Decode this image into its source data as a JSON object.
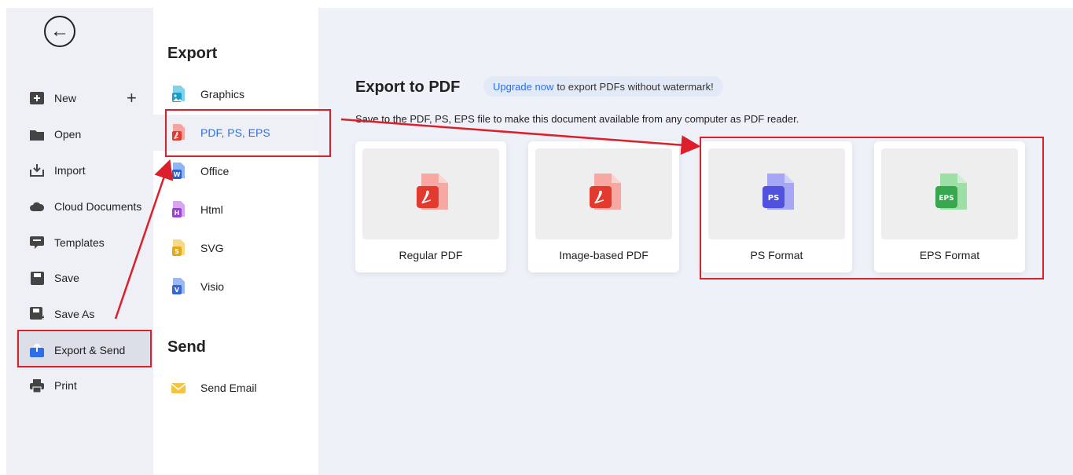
{
  "back_button": {
    "icon": "arrow-left-icon"
  },
  "menu": [
    {
      "label": "New",
      "icon": "new-icon",
      "extra": "+"
    },
    {
      "label": "Open",
      "icon": "folder-icon"
    },
    {
      "label": "Import",
      "icon": "import-icon"
    },
    {
      "label": "Cloud Documents",
      "icon": "cloud-icon"
    },
    {
      "label": "Templates",
      "icon": "templates-icon"
    },
    {
      "label": "Save",
      "icon": "save-icon"
    },
    {
      "label": "Save As",
      "icon": "save-as-icon"
    },
    {
      "label": "Export & Send",
      "icon": "export-icon",
      "active": true
    },
    {
      "label": "Print",
      "icon": "print-icon"
    }
  ],
  "export_section": {
    "title": "Export",
    "items": [
      {
        "label": "Graphics",
        "icon": "graphics-icon"
      },
      {
        "label": "PDF, PS, EPS",
        "icon": "pdf-icon",
        "selected": true
      },
      {
        "label": "Office",
        "icon": "office-icon"
      },
      {
        "label": "Html",
        "icon": "html-icon"
      },
      {
        "label": "SVG",
        "icon": "svg-icon"
      },
      {
        "label": "Visio",
        "icon": "visio-icon"
      }
    ]
  },
  "send_section": {
    "title": "Send",
    "items": [
      {
        "label": "Send Email",
        "icon": "email-icon"
      }
    ]
  },
  "main": {
    "title": "Export to PDF",
    "upgrade_link": "Upgrade now",
    "upgrade_text": "to export PDFs without watermark!",
    "description": "Save to the PDF, PS, EPS file to make this document available from any computer as PDF reader.",
    "cards": [
      {
        "label": "Regular PDF",
        "icon": "pdf-file-icon",
        "badge": ""
      },
      {
        "label": "Image-based PDF",
        "icon": "pdf-file-icon",
        "badge": ""
      },
      {
        "label": "PS Format",
        "icon": "ps-file-icon",
        "badge": "PS"
      },
      {
        "label": "EPS Format",
        "icon": "eps-file-icon",
        "badge": "EPS"
      }
    ]
  },
  "colors": {
    "accent": "#2e6ee8",
    "highlight_red": "#dc1f2b",
    "pdf_red": "#e9463d",
    "ps_purple": "#5b5ce6",
    "eps_green": "#3fae58"
  }
}
